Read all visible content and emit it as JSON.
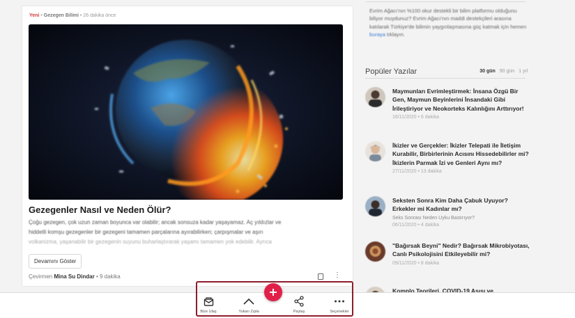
{
  "article": {
    "tag_new": "Yeni",
    "separator": "•",
    "category": "Gezegen Bilimi",
    "time_ago": "• 26 dakika önce",
    "title": "Gezegenler Nasıl ve Neden Ölür?",
    "excerpt_lines": [
      "Çoğu gezegen, çok uzun zaman boyunca var olabilir; ancak sonsuza kadar yaşayamaz. Aç yıldızlar ve",
      "hiddetli komşu gezegenler bir gezegeni tamamen parçalarına ayırabilirken; çarpışmalar ve aşırı",
      "volkanizma, yaşanabilir bir gezegenin suyunu buharlaştırarak yaşamı tamamen yok edebilir. Ayrıca"
    ],
    "show_more_label": "Devamını Göster",
    "translator_label": "Çevirmen",
    "translator_name": "Mina Su Dindar",
    "read_time": "• 9 dakika"
  },
  "sidebar": {
    "support_text": "Evrim Ağacı'nın %100 okur destekli bir bilim platformu olduğunu biliyor muydunuz? Evrim Ağacı'nın maddi destekçileri arasına katılarak Türkiye'de bilimin yaygınlaşmasına güç katmak için hemen",
    "support_link": "buraya",
    "support_tail": "tıklayın.",
    "popular_title": "Popüler Yazılar",
    "tabs": [
      "30 gün",
      "90 gün",
      "1 yıl"
    ],
    "popular": [
      {
        "title": "Maymunları Evrimleştirmek: İnsana Özgü Bir Gen, Maymun Beyinlerini İnsandaki Gibi İrileştiriyor ve Neokorteks Kalınlığını Arttırıyor!",
        "subtitle": "",
        "date": "16/11/2020 • 6 dakika"
      },
      {
        "title": "İkizler ve Gerçekler: İkizler Telepati ile İletişim Kurabilir, Birbirlerinin Acısını Hissedebilirler mi? İkizlerin Parmak İzi ve Genleri Aynı mı?",
        "subtitle": "",
        "date": "27/11/2020 • 13 dakika"
      },
      {
        "title": "Seksten Sonra Kim Daha Çabuk Uyuyor? Erkekler mi Kadınlar mı?",
        "subtitle": "Seks Sonrası Neden Uyku Bastırıyor?",
        "date": "06/11/2020 • 4 dakika"
      },
      {
        "title": "\"Bağırsak Beyni\" Nedir? Bağırsak Mikrobiyotası, Canlı Psikolojisini Etkileyebilir mi?",
        "subtitle": "",
        "date": "09/11/2020 • 8 dakika"
      },
      {
        "title": "Komplo Teorileri, COVID-19 Aşısı ve",
        "subtitle": "",
        "date": ""
      }
    ]
  },
  "toolbar": {
    "contact_label": "Bize Ulaş",
    "top_label": "Yukarı Zıpla",
    "share_label": "Paylaş",
    "options_label": "Seçenekler",
    "accent": "#e1204a",
    "frame_color": "#8c1d2c"
  }
}
